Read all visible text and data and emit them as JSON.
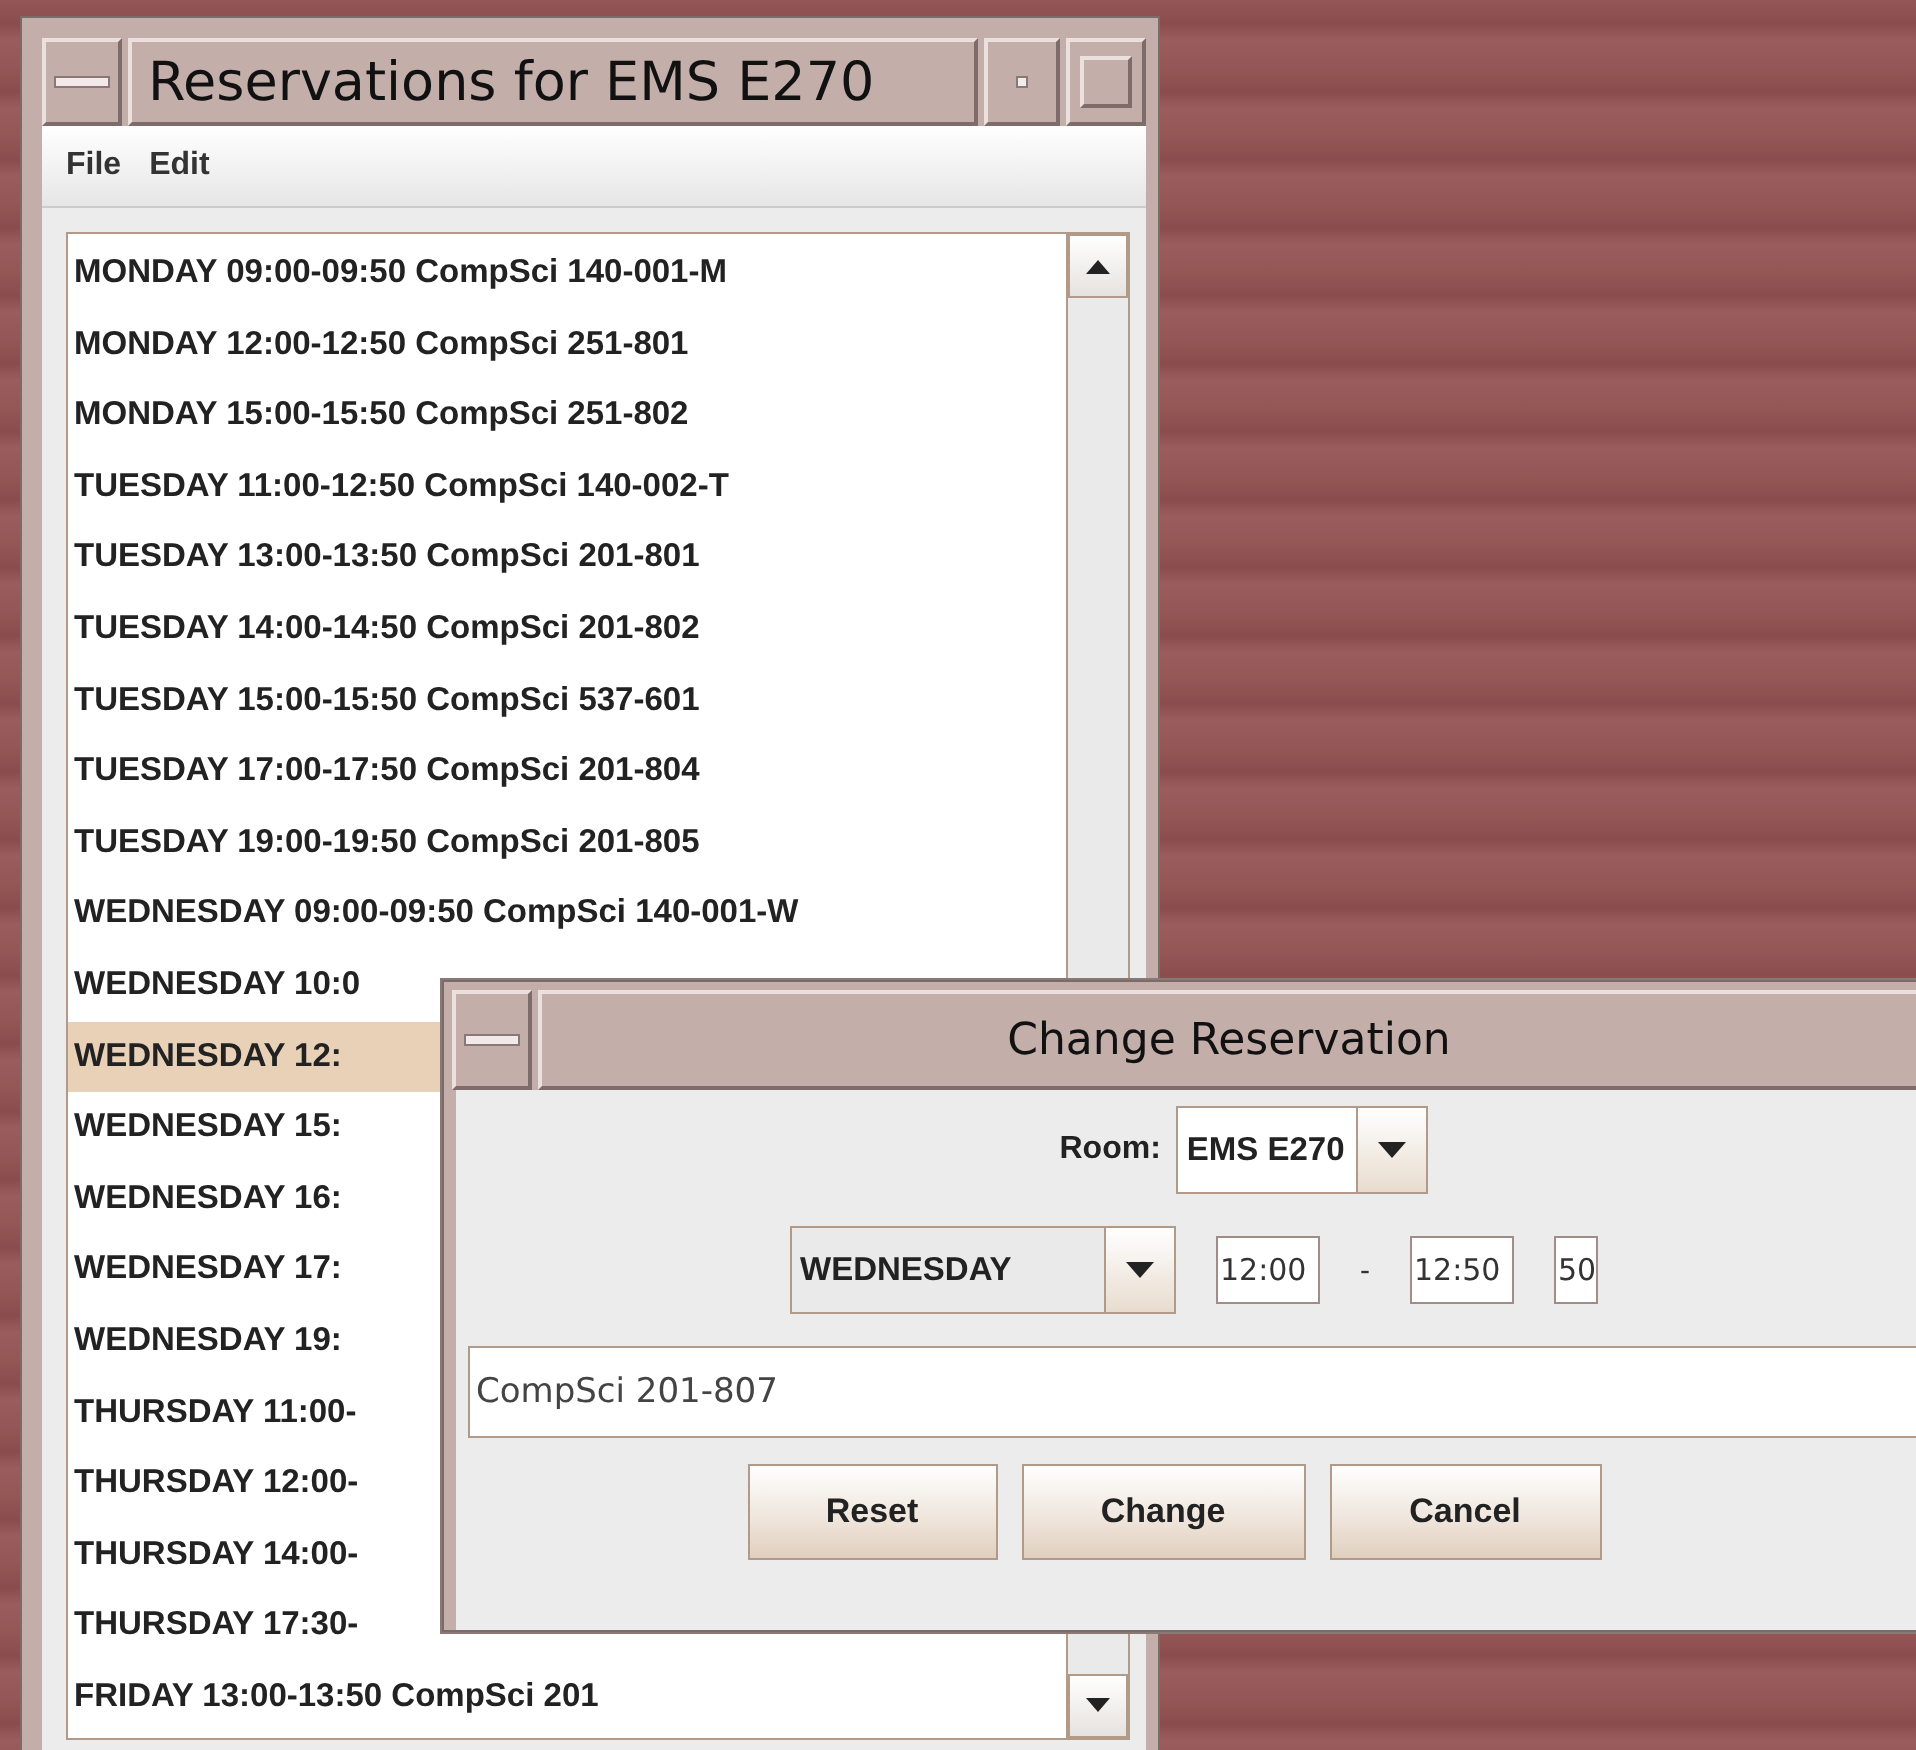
{
  "main_window": {
    "title": "Reservations for EMS E270",
    "menu": [
      "File",
      "Edit"
    ],
    "reservations": [
      {
        "text": "MONDAY 09:00-09:50 CompSci 140-001-M",
        "selected": false
      },
      {
        "text": "MONDAY 12:00-12:50 CompSci 251-801",
        "selected": false
      },
      {
        "text": "MONDAY 15:00-15:50 CompSci 251-802",
        "selected": false
      },
      {
        "text": "TUESDAY 11:00-12:50 CompSci 140-002-T",
        "selected": false
      },
      {
        "text": "TUESDAY 13:00-13:50 CompSci 201-801",
        "selected": false
      },
      {
        "text": "TUESDAY 14:00-14:50 CompSci 201-802",
        "selected": false
      },
      {
        "text": "TUESDAY 15:00-15:50 CompSci 537-601",
        "selected": false
      },
      {
        "text": "TUESDAY 17:00-17:50 CompSci 201-804",
        "selected": false
      },
      {
        "text": "TUESDAY 19:00-19:50 CompSci 201-805",
        "selected": false
      },
      {
        "text": "WEDNESDAY 09:00-09:50 CompSci 140-001-W",
        "selected": false
      },
      {
        "text": "WEDNESDAY 10:0",
        "selected": false
      },
      {
        "text": "WEDNESDAY 12:",
        "selected": true
      },
      {
        "text": "WEDNESDAY 15:",
        "selected": false
      },
      {
        "text": "WEDNESDAY 16:",
        "selected": false
      },
      {
        "text": "WEDNESDAY 17:",
        "selected": false
      },
      {
        "text": "WEDNESDAY 19:",
        "selected": false
      },
      {
        "text": "THURSDAY 11:00-",
        "selected": false
      },
      {
        "text": "THURSDAY 12:00-",
        "selected": false
      },
      {
        "text": "THURSDAY 14:00-",
        "selected": false
      },
      {
        "text": "THURSDAY 17:30-",
        "selected": false
      },
      {
        "text": "FRIDAY 13:00-13:50 CompSci 201",
        "selected": false
      }
    ]
  },
  "dialog": {
    "title": "Change Reservation",
    "room_label": "Room:",
    "room": "EMS E270",
    "day": "WEDNESDAY",
    "start": "12:00",
    "separator": "-",
    "end": "12:50",
    "duration": "50",
    "description": "CompSci 201-807",
    "buttons": [
      "Reset",
      "Change",
      "Cancel"
    ]
  }
}
